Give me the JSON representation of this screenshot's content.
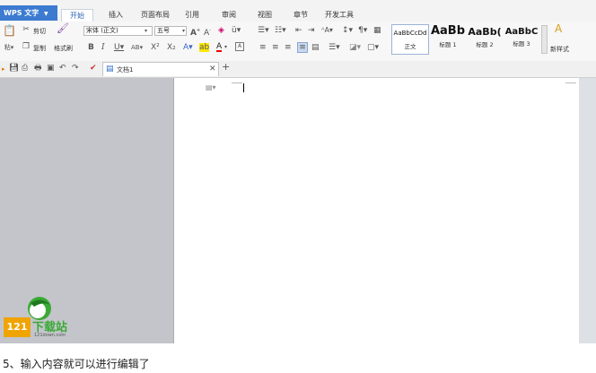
{
  "app": {
    "name": "WPS 文字"
  },
  "menu_tabs": [
    {
      "label": "开始",
      "active": true
    },
    {
      "label": "插入"
    },
    {
      "label": "页面布局"
    },
    {
      "label": "引用"
    },
    {
      "label": "审阅"
    },
    {
      "label": "视图"
    },
    {
      "label": "章节"
    },
    {
      "label": "开发工具"
    }
  ],
  "clipboard": {
    "cut": "剪切",
    "copy": "复制",
    "format_painter": "格式刷"
  },
  "font": {
    "name": "宋体 (正文)",
    "size": "五号"
  },
  "styles": [
    {
      "preview": "AaBbCcDd",
      "name": "正文"
    },
    {
      "preview": "AaBb",
      "name": "标题 1"
    },
    {
      "preview": "AaBb(",
      "name": "标题 2"
    },
    {
      "preview": "AaBbC",
      "name": "标题 3"
    }
  ],
  "new_style": "新样式",
  "document": {
    "tab_title": "文档1"
  },
  "watermark": {
    "text": "下载站",
    "prefix": "121",
    "url": "121down.com"
  },
  "caption": "5、输入内容就可以进行编辑了",
  "colors": {
    "accent": "#3c7bd0",
    "page_bg": "#ffffff",
    "pane_bg": "#c3c5ca",
    "logo_green": "#3aa935"
  }
}
